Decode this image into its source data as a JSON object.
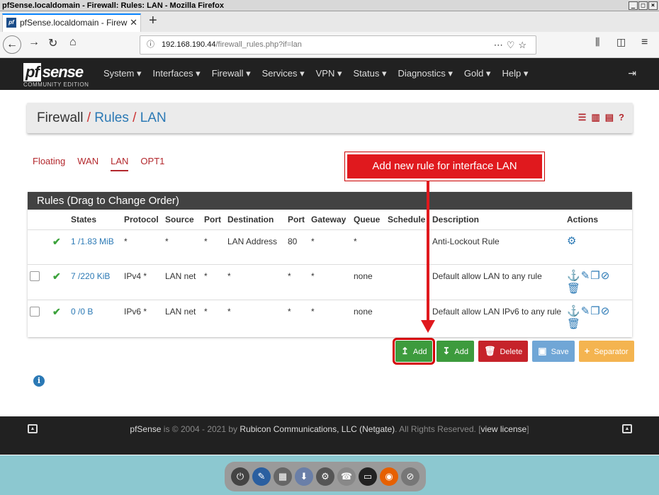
{
  "window": {
    "title": "pfSense.localdomain - Firewall: Rules: LAN - Mozilla Firefox"
  },
  "browser": {
    "tab_title": "pfSense.localdomain - Firew",
    "url_host": "192.168.190.44",
    "url_path": "/firewall_rules.php?if=lan"
  },
  "nav": {
    "logo": "sense",
    "logo_prefix": "pf",
    "logo_sub": "COMMUNITY EDITION",
    "menu": [
      "System ▾",
      "Interfaces ▾",
      "Firewall ▾",
      "Services ▾",
      "VPN ▾",
      "Status ▾",
      "Diagnostics ▾",
      "Gold ▾",
      "Help ▾"
    ]
  },
  "breadcrumb": {
    "root": "Firewall",
    "sep": "/",
    "rules": "Rules",
    "lan": "LAN"
  },
  "tabs": [
    "Floating",
    "WAN",
    "LAN",
    "OPT1"
  ],
  "callout": "Add new rule for interface LAN",
  "rules_panel": {
    "title": "Rules (Drag to Change Order)",
    "headers": [
      "",
      "",
      "States",
      "Protocol",
      "Source",
      "Port",
      "Destination",
      "Port",
      "Gateway",
      "Queue",
      "Schedule",
      "Description",
      "Actions"
    ],
    "rows": [
      {
        "states": "1 /1.83 MiB",
        "protocol": "*",
        "source": "*",
        "sport": "*",
        "destination": "LAN Address",
        "dport": "80",
        "gateway": "*",
        "queue": "*",
        "schedule": "",
        "description": "Anti-Lockout Rule"
      },
      {
        "states": "7 /220 KiB",
        "protocol": "IPv4 *",
        "source": "LAN net",
        "sport": "*",
        "destination": "*",
        "dport": "*",
        "gateway": "*",
        "queue": "none",
        "schedule": "",
        "description": "Default allow LAN to any rule"
      },
      {
        "states": "0 /0 B",
        "protocol": "IPv6 *",
        "source": "LAN net",
        "sport": "*",
        "destination": "*",
        "dport": "*",
        "gateway": "*",
        "queue": "none",
        "schedule": "",
        "description": "Default allow LAN IPv6 to any rule"
      }
    ]
  },
  "buttons": {
    "add_top": "Add",
    "add_bottom": "Add",
    "delete": "Delete",
    "save": "Save",
    "separator": "Separator"
  },
  "footer": {
    "brand": "pfSense",
    "text1": " is © 2004 - 2021 by ",
    "company": "Rubicon Communications, LLC (Netgate)",
    "text2": ". All Rights Reserved. [",
    "license": "view license",
    "text3": "]"
  },
  "colors": {
    "accent": "#b3282d",
    "link": "#2b79b5",
    "success": "#3d9b3d"
  }
}
